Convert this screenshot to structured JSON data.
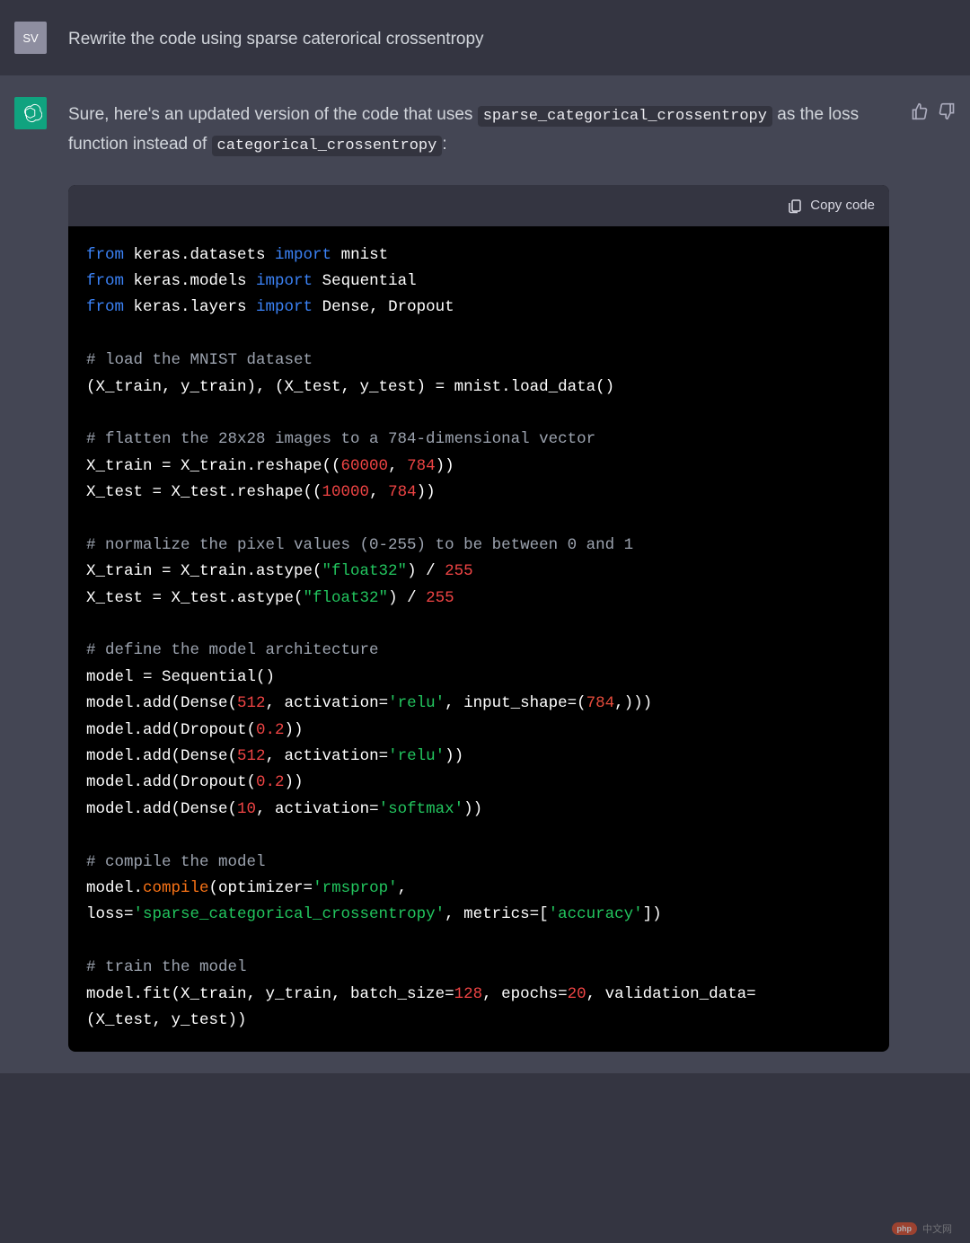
{
  "user": {
    "avatar_initials": "SV",
    "message": "Rewrite the code using sparse caterorical crossentropy"
  },
  "assistant": {
    "intro_text": "Sure, here's an updated version of the code that uses ",
    "inline_code_1": "sparse_categorical_crossentropy",
    "mid_text": " as the loss function instead of ",
    "inline_code_2": "categorical_crossentropy",
    "outro_text": ":"
  },
  "code_block": {
    "copy_label": "Copy code",
    "lines": {
      "l1_from": "from",
      "l1_mod": " keras.datasets ",
      "l1_import": "import",
      "l1_name": " mnist",
      "l2_from": "from",
      "l2_mod": " keras.models ",
      "l2_import": "import",
      "l2_name": " Sequential",
      "l3_from": "from",
      "l3_mod": " keras.layers ",
      "l3_import": "import",
      "l3_name": " Dense, Dropout",
      "c1": "# load the MNIST dataset",
      "l4": "(X_train, y_train), (X_test, y_test) = mnist.load_data()",
      "c2": "# flatten the 28x28 images to a 784-dimensional vector",
      "l5a": "X_train = X_train.reshape((",
      "l5n1": "60000",
      "l5c": ", ",
      "l5n2": "784",
      "l5e": "))",
      "l6a": "X_test = X_test.reshape((",
      "l6n1": "10000",
      "l6c": ", ",
      "l6n2": "784",
      "l6e": "))",
      "c3": "# normalize the pixel values (0-255) to be between 0 and 1",
      "l7a": "X_train = X_train.astype(",
      "l7s": "\"float32\"",
      "l7b": ") / ",
      "l7n": "255",
      "l8a": "X_test = X_test.astype(",
      "l8s": "\"float32\"",
      "l8b": ") / ",
      "l8n": "255",
      "c4": "# define the model architecture",
      "l9": "model = Sequential()",
      "l10a": "model.add(Dense(",
      "l10n1": "512",
      "l10b": ", activation=",
      "l10s": "'relu'",
      "l10c": ", input_shape=(",
      "l10n2": "784",
      "l10d": ",)))",
      "l11a": "model.add(Dropout(",
      "l11n": "0.2",
      "l11b": "))",
      "l12a": "model.add(Dense(",
      "l12n": "512",
      "l12b": ", activation=",
      "l12s": "'relu'",
      "l12c": "))",
      "l13a": "model.add(Dropout(",
      "l13n": "0.2",
      "l13b": "))",
      "l14a": "model.add(Dense(",
      "l14n": "10",
      "l14b": ", activation=",
      "l14s": "'softmax'",
      "l14c": "))",
      "c5": "# compile the model",
      "l15a": "model.",
      "l15f": "compile",
      "l15b": "(optimizer=",
      "l15s": "'rmsprop'",
      "l15c": ",",
      "l16a": "loss=",
      "l16s": "'sparse_categorical_crossentropy'",
      "l16b": ", metrics=[",
      "l16s2": "'accuracy'",
      "l16c": "])",
      "c6": "# train the model",
      "l17a": "model.fit(X_train, y_train, batch_size=",
      "l17n1": "128",
      "l17b": ", epochs=",
      "l17n2": "20",
      "l17c": ", validation_data=",
      "l18": "(X_test, y_test))"
    }
  },
  "watermark": {
    "badge": "php",
    "text": "中文网"
  }
}
